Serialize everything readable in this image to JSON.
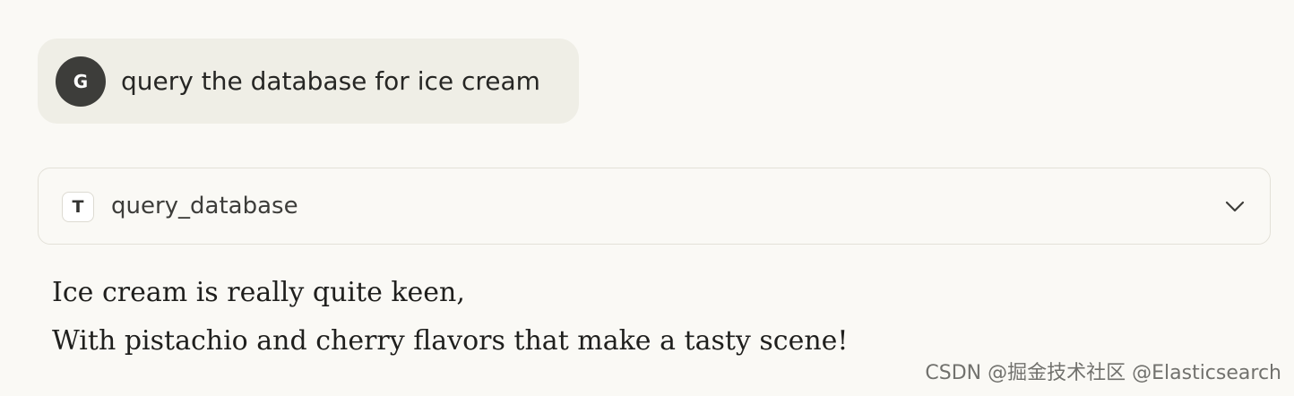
{
  "user_message": {
    "avatar_initial": "G",
    "text": "query the database for ice cream"
  },
  "tool_call": {
    "icon_letter": "T",
    "name": "query_database",
    "expand_icon": "chevron-down-icon"
  },
  "response": {
    "lines": [
      "Ice cream is really quite keen,",
      "With pistachio and cherry flavors that make a tasty scene!"
    ]
  },
  "watermark": {
    "text": "CSDN @掘金技术社区 @Elasticsearch"
  },
  "colors": {
    "background": "#faf9f5",
    "user_bubble": "#efeee6",
    "avatar": "#3d3d3a",
    "card_border": "#e3e1d8"
  }
}
